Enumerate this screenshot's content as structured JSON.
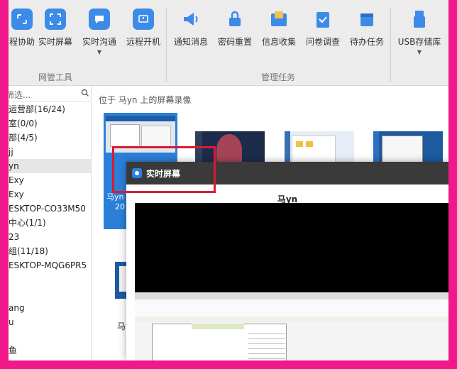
{
  "ribbon": {
    "items": [
      {
        "label": "程协助"
      },
      {
        "label": "实时屏幕"
      },
      {
        "label": "实时沟通"
      },
      {
        "label": "远程开机"
      },
      {
        "label": "通知消息"
      },
      {
        "label": "密码重置"
      },
      {
        "label": "信息收集"
      },
      {
        "label": "问卷调查"
      },
      {
        "label": "待办任务"
      },
      {
        "label": "USB存储库"
      }
    ],
    "groups": [
      "网管工具",
      "管理任务"
    ]
  },
  "sidebar": {
    "search_placeholder": "筛选...",
    "items": [
      {
        "label": "运营部(16/24)"
      },
      {
        "label": "室(0/0)"
      },
      {
        "label": "部(4/5)"
      },
      {
        "label": "jj"
      },
      {
        "label": "yn"
      },
      {
        "label": "Exy"
      },
      {
        "label": "Exy"
      },
      {
        "label": "ESKTOP-CO33M50"
      },
      {
        "label": "中心(1/1)"
      },
      {
        "label": "23"
      },
      {
        "label": "组(11/18)"
      },
      {
        "label": "ESKTOP-MQG6PR5"
      },
      {
        "label": ""
      },
      {
        "label": ""
      },
      {
        "label": "ang"
      },
      {
        "label": "u"
      },
      {
        "label": ""
      },
      {
        "label": "鱼"
      }
    ]
  },
  "content": {
    "location": "位于 马yn 上的屏幕录像",
    "thumb_labels": [
      "马yn",
      "20",
      "马yn",
      "20"
    ]
  },
  "modal": {
    "title": "实时屏幕",
    "user": "马yn"
  },
  "colors": {
    "border": "#f0188a",
    "accent": "#3d8be8",
    "highlight": "#d91b2f"
  }
}
